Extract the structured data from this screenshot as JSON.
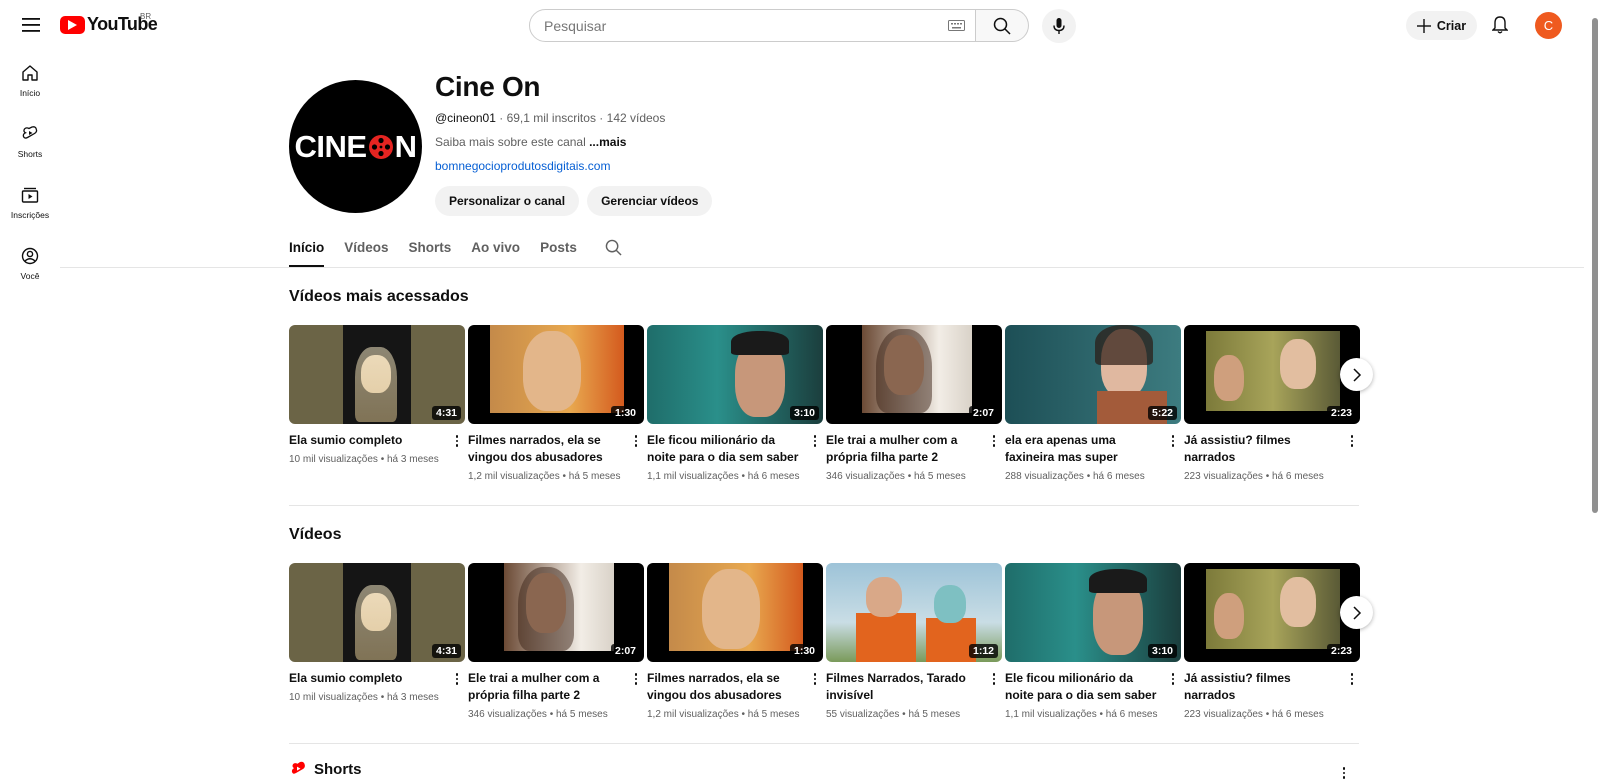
{
  "topbar": {
    "logo_text": "YouTube",
    "country": "BR",
    "search_placeholder": "Pesquisar",
    "create_label": "Criar",
    "avatar_letter": "C"
  },
  "sidebar": {
    "items": [
      {
        "label": "Início",
        "icon": "home-icon"
      },
      {
        "label": "Shorts",
        "icon": "shorts-icon"
      },
      {
        "label": "Inscrições",
        "icon": "subscriptions-icon"
      },
      {
        "label": "Você",
        "icon": "you-icon"
      }
    ]
  },
  "channel": {
    "avatar_text_left": "CINE",
    "avatar_text_right": "N",
    "title": "Cine On",
    "handle": "@cineon01",
    "subscribers": "69,1 mil inscritos",
    "video_count": "142 vídeos",
    "about_text": "Saiba mais sobre este canal",
    "about_more": "...mais",
    "link": "bomnegocioprodutosdigitais.com",
    "customize_label": "Personalizar o canal",
    "manage_label": "Gerenciar vídeos"
  },
  "tabs": [
    "Início",
    "Vídeos",
    "Shorts",
    "Ao vivo",
    "Posts"
  ],
  "sections": {
    "popular_title": "Vídeos mais acessados",
    "videos_title": "Vídeos",
    "shorts_title": "Shorts"
  },
  "popular_videos": [
    {
      "title": "Ela sumio completo",
      "duration": "4:31",
      "views": "10 mil visualizações",
      "age": "há 3 meses"
    },
    {
      "title": "Filmes narrados, ela se vingou dos abusadores",
      "duration": "1:30",
      "views": "1,2 mil visualizações",
      "age": "há 5 meses"
    },
    {
      "title": "Ele ficou milionário da noite para o dia sem saber o...",
      "duration": "3:10",
      "views": "1,1 mil visualizações",
      "age": "há 6 meses"
    },
    {
      "title": "Ele trai a mulher com a própria filha parte 2",
      "duration": "2:07",
      "views": "346 visualizações",
      "age": "há 5 meses"
    },
    {
      "title": "ela era apenas uma faxineira mas super inteligente",
      "duration": "5:22",
      "views": "288 visualizações",
      "age": "há 6 meses"
    },
    {
      "title": "Já assistiu? filmes narrados",
      "duration": "2:23",
      "views": "223 visualizações",
      "age": "há 6 meses"
    }
  ],
  "recent_videos": [
    {
      "title": "Ela sumio completo",
      "duration": "4:31",
      "views": "10 mil visualizações",
      "age": "há 3 meses"
    },
    {
      "title": "Ele trai a mulher com a própria filha parte 2",
      "duration": "2:07",
      "views": "346 visualizações",
      "age": "há 5 meses"
    },
    {
      "title": "Filmes narrados, ela se vingou dos abusadores",
      "duration": "1:30",
      "views": "1,2 mil visualizações",
      "age": "há 5 meses"
    },
    {
      "title": "Filmes Narrados, Tarado invisível",
      "duration": "1:12",
      "views": "55 visualizações",
      "age": "há 5 meses"
    },
    {
      "title": "Ele ficou milionário da noite para o dia sem saber o...",
      "duration": "3:10",
      "views": "1,1 mil visualizações",
      "age": "há 6 meses"
    },
    {
      "title": "Já assistiu? filmes narrados",
      "duration": "2:23",
      "views": "223 visualizações",
      "age": "há 6 meses"
    }
  ],
  "colors": {
    "brand_red": "#ff0000",
    "avatar_orange": "#ef5a1f",
    "link_blue": "#065fd4"
  }
}
